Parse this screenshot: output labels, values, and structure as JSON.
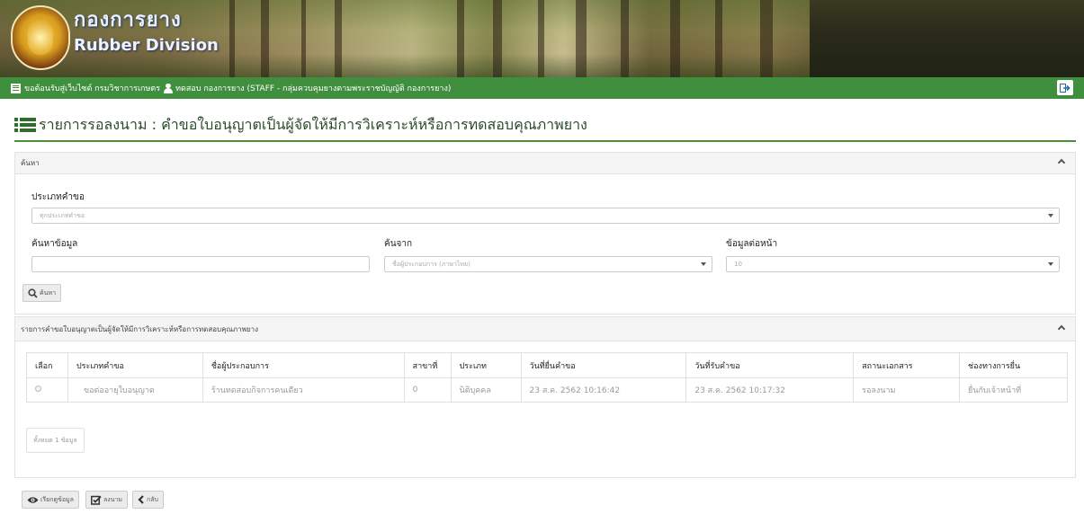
{
  "banner": {
    "title_th": "กองการยาง",
    "title_en": "Rubber Division"
  },
  "infobar": {
    "welcome_text": "ขอต้อนรับสู่เว็บไซต์ กรมวิชาการเกษตร",
    "user_text": "ทดสอบ กองการยาง (STAFF - กลุ่มควบคุมยางตามพระราชบัญญัติ กองการยาง)"
  },
  "page": {
    "title": "รายการรอลงนาม : คำขอใบอนุญาตเป็นผู้จัดให้มีการวิเคราะห์หรือการทดสอบคุณภาพยาง"
  },
  "search_panel": {
    "header": "ค้นหา",
    "request_type_label": "ประเภทคำขอ",
    "request_type_value": "ทุกประเภทคำขอ",
    "keyword_label": "ค้นหาข้อมูล",
    "keyword_value": "",
    "search_from_label": "ค้นจาก",
    "search_from_value": "ชื่อผู้ประกอบการ (ภาษาไทย)",
    "per_page_label": "ข้อมูลต่อหน้า",
    "per_page_value": "10",
    "search_button": "ค้นหา"
  },
  "results_panel": {
    "header": "รายการคำขอใบอนุญาตเป็นผู้จัดให้มีการวิเคราะห์หรือการทดสอบคุณภาพยาง",
    "columns": [
      "เลือก",
      "ประเภทคำขอ",
      "ชื่อผู้ประกอบการ",
      "สาขาที่",
      "ประเภท",
      "วันที่ยื่นคำขอ",
      "วันที่รับคำขอ",
      "สถานะเอกสาร",
      "ช่องทางการยื่น"
    ],
    "rows": [
      {
        "request_type": "ขอต่ออายุใบอนุญาต",
        "operator": "ร้านทดสอบกิจการคนเดียว",
        "branch": "0",
        "type": "นิติบุคคล",
        "submitted": "23 ส.ค. 2562 10:16:42",
        "received": "23 ส.ค. 2562 10:17:32",
        "status": "รอลงนาม",
        "channel": "ยื่นกับเจ้าหน้าที่"
      }
    ],
    "total_text": "ทั้งหมด 1 ข้อมูล"
  },
  "actions": {
    "view_label": "เรียกดูข้อมูล",
    "sign_label": "ลงนาม",
    "back_label": "กลับ"
  },
  "colors": {
    "infobar": "#3f8f3f",
    "accent": "#2d6f2a"
  }
}
